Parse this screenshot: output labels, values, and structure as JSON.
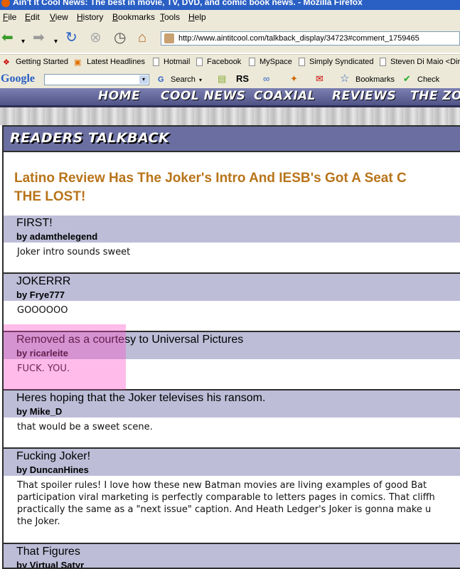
{
  "window": {
    "title": "Ain't It Cool News: The best in movie, TV, DVD, and comic book news. - Mozilla Firefox"
  },
  "menu": {
    "items": [
      "File",
      "Edit",
      "View",
      "History",
      "Bookmarks",
      "Tools",
      "Help"
    ]
  },
  "nav": {
    "url": "http://www.aintitcool.com/talkback_display/34723#comment_1759465"
  },
  "bookmarks": {
    "items": [
      "Getting Started",
      "Latest Headlines",
      "Hotmail",
      "Facebook",
      "MySpace",
      "Simply Syndicated",
      "Steven Di Maio <Dirt"
    ]
  },
  "googlebar": {
    "logo": "Google",
    "search": "Search",
    "bookmarks": "Bookmarks",
    "check": "Check",
    "rs": "RS"
  },
  "site_nav": {
    "items": [
      "HOME",
      "COOL NEWS",
      "COAXIAL",
      "REVIEWS",
      "THE ZONE"
    ]
  },
  "talkback": {
    "heading": "READERS TALKBACK",
    "article_title_line1": "Latino Review Has The Joker's Intro And IESB's Got A Seat C",
    "article_title_line2": "THE LOST!",
    "comments": [
      {
        "title": "FIRST!",
        "author": "by adamthelegend",
        "body": [
          "Joker intro sounds sweet"
        ]
      },
      {
        "title": "JOKERRR",
        "author": "by Frye777",
        "body": [
          "GOOOOOO"
        ]
      },
      {
        "title": "Removed as a courtesy to Universal Pictures",
        "author": "by ricarleite",
        "body": [
          "FUCK. YOU."
        ]
      },
      {
        "title": "Heres hoping that the Joker televises his ransom.",
        "author": "by Mike_D",
        "body": [
          "that would be a sweet scene."
        ]
      },
      {
        "title": "Fucking Joker!",
        "author": "by DuncanHines",
        "body": [
          "That spoiler rules! I love how these new Batman movies are living examples of good Bat",
          "participation viral marketing is perfectly comparable to letters pages in comics. That cliffh",
          "practically the same as a \"next issue\" caption. And Heath Ledger's Joker is gonna make u",
          "the Joker."
        ]
      },
      {
        "title": "That Figures",
        "author": "by Virtual Satyr",
        "body": []
      }
    ]
  }
}
